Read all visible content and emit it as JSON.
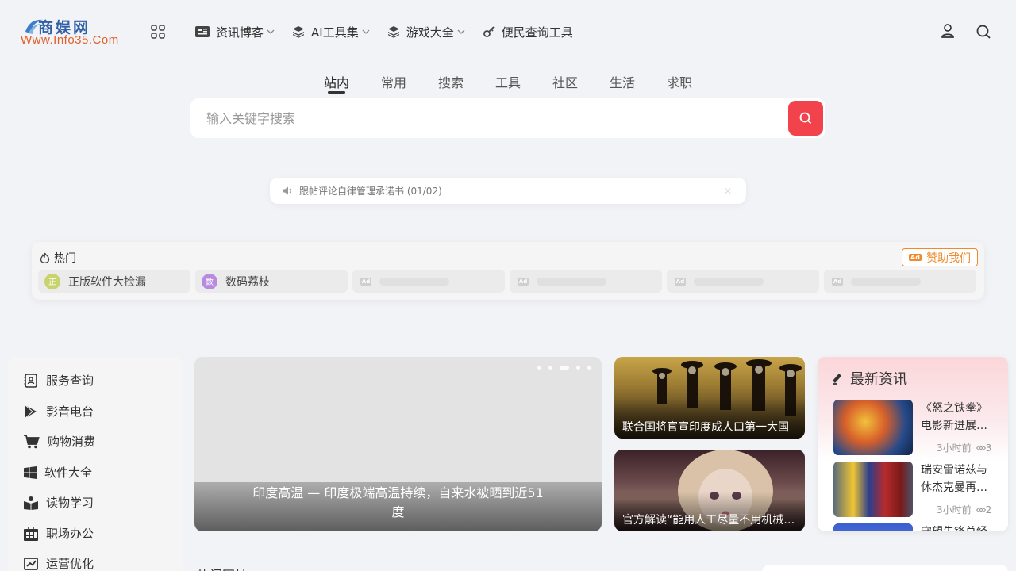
{
  "header": {
    "logo_cn": "商娱网",
    "logo_en": "Www.Info35.Com",
    "nav": [
      {
        "label": "资讯博客",
        "icon": "newspaper-icon",
        "dropdown": true
      },
      {
        "label": "AI工具集",
        "icon": "layers-icon",
        "dropdown": true
      },
      {
        "label": "游戏大全",
        "icon": "layers-icon",
        "dropdown": true
      },
      {
        "label": "便民查询工具",
        "icon": "key-icon",
        "dropdown": false
      }
    ]
  },
  "search": {
    "tabs": [
      "站内",
      "常用",
      "搜索",
      "工具",
      "社区",
      "生活",
      "求职"
    ],
    "active_tab": "站内",
    "placeholder": "输入关键字搜索",
    "button_color": "#f2434c"
  },
  "notice": {
    "text": "跟帖评论自律管理承诺书 (01/02)",
    "close": "✕"
  },
  "hot": {
    "title": "热门",
    "sponsor_ad": "Ad",
    "sponsor_label": "赞助我们",
    "items": [
      {
        "badge": "正",
        "label": "正版软件大捡漏",
        "color": "#c9d36b"
      },
      {
        "badge": "数",
        "label": "数码荔枝",
        "color": "#b98be0"
      }
    ],
    "ad_placeholder": "Ad"
  },
  "sidebar": {
    "items": [
      {
        "label": "服务查询",
        "icon": "contact-card-icon"
      },
      {
        "label": "影音电台",
        "icon": "play-store-icon"
      },
      {
        "label": "购物消费",
        "icon": "cart-icon"
      },
      {
        "label": "软件大全",
        "icon": "windows-icon"
      },
      {
        "label": "读物学习",
        "icon": "reader-icon"
      },
      {
        "label": "职场办公",
        "icon": "office-icon"
      },
      {
        "label": "运营优化",
        "icon": "chart-icon"
      }
    ]
  },
  "carousel": {
    "caption": "印度高温 — 印度极端高温持续，自来水被晒到近51度",
    "slides": 5,
    "active": 3
  },
  "cards": [
    {
      "caption": "联合国将官宣印度成人口第一大国"
    },
    {
      "caption": "官方解读“能用人工尽量不用机械”说法"
    }
  ],
  "news": {
    "title": "最新资讯",
    "items": [
      {
        "title": "《怒之铁拳》电影新进展…",
        "time": "3小时前",
        "views": "3"
      },
      {
        "title": "瑞安雷诺兹与休杰克曼再…",
        "time": "3小时前",
        "views": "2"
      },
      {
        "title": "守望先锋总经",
        "time": "",
        "views": ""
      }
    ]
  },
  "bottom": {
    "title": "热门网址"
  }
}
